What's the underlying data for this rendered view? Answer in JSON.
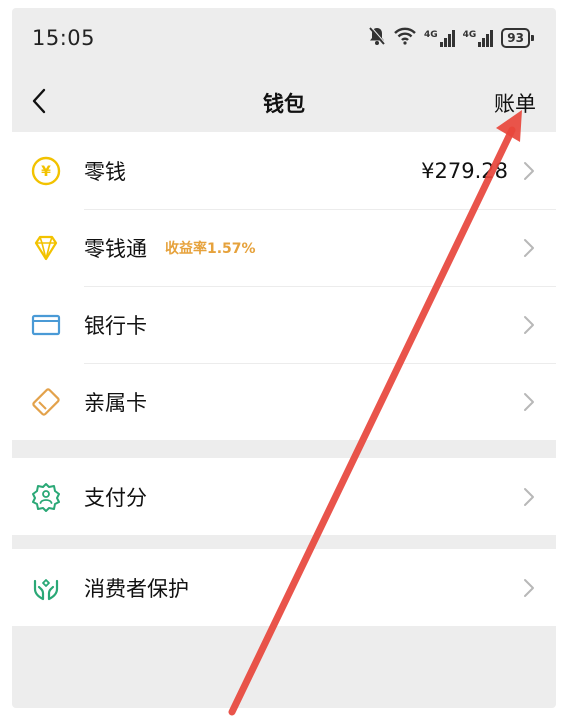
{
  "status_bar": {
    "time": "15:05",
    "signal1_label": "4G",
    "signal2_label": "4G",
    "battery": "93",
    "icons": [
      "bell-mute-icon",
      "wifi-icon",
      "signal-4g-icon",
      "signal-4g-icon",
      "battery-icon"
    ]
  },
  "nav": {
    "title": "钱包",
    "right_label": "账单",
    "back_icon": "chevron-left-icon"
  },
  "groups": [
    {
      "items": [
        {
          "label": "零钱",
          "value": "¥279.28",
          "icon": "yuan-coin-icon"
        },
        {
          "label": "零钱通",
          "badge": "收益率1.57%",
          "icon": "diamond-icon"
        },
        {
          "label": "银行卡",
          "icon": "bank-card-icon"
        },
        {
          "label": "亲属卡",
          "icon": "family-card-icon"
        }
      ]
    },
    {
      "items": [
        {
          "label": "支付分",
          "icon": "pay-score-icon"
        }
      ]
    },
    {
      "items": [
        {
          "label": "消费者保护",
          "icon": "consumer-protection-icon"
        }
      ]
    }
  ],
  "colors": {
    "background": "#ededed",
    "panel": "#ffffff",
    "accent_yellow": "#f2c200",
    "badge_orange": "#e6a23c",
    "bank_blue": "#4a9ad6",
    "family_orange": "#e3a24b",
    "green": "#2aa876",
    "annotation_arrow": "#e8463c"
  }
}
